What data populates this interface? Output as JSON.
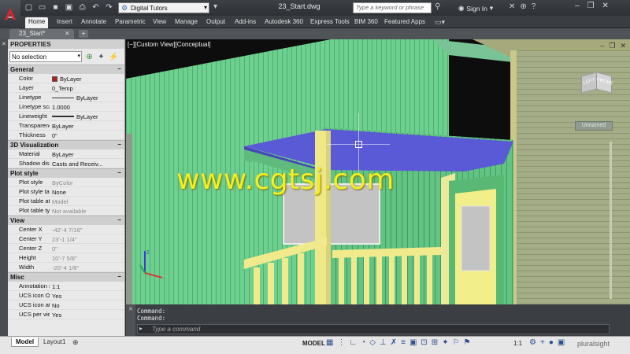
{
  "window": {
    "doc_title": "23_Start.dwg",
    "workspace": "Digital Tutors",
    "search_placeholder": "Type a keyword or phrase",
    "sign_in": "Sign In"
  },
  "ribbon": {
    "tabs": [
      "Home",
      "Insert",
      "Annotate",
      "Parametric",
      "View",
      "Manage",
      "Output",
      "Add-ins",
      "Autodesk 360",
      "Express Tools",
      "BIM 360",
      "Featured Apps"
    ],
    "active": "Home"
  },
  "file_tab": {
    "name": "23_Start*"
  },
  "properties": {
    "title": "PROPERTIES",
    "selection": "No selection",
    "sections": {
      "general": {
        "title": "General",
        "rows": [
          {
            "k": "Color",
            "v": "ByLayer"
          },
          {
            "k": "Layer",
            "v": "0_Temp"
          },
          {
            "k": "Linetype",
            "v": "ByLayer"
          },
          {
            "k": "Linetype scale",
            "v": "1.0000"
          },
          {
            "k": "Lineweight",
            "v": "ByLayer"
          },
          {
            "k": "Transparency",
            "v": "ByLayer"
          },
          {
            "k": "Thickness",
            "v": "0\""
          }
        ]
      },
      "viz3d": {
        "title": "3D Visualization",
        "rows": [
          {
            "k": "Material",
            "v": "ByLayer"
          },
          {
            "k": "Shadow disp...",
            "v": "Casts and Receiv..."
          }
        ]
      },
      "plot": {
        "title": "Plot style",
        "rows": [
          {
            "k": "Plot style",
            "v": "ByColor"
          },
          {
            "k": "Plot style ta...",
            "v": "None"
          },
          {
            "k": "Plot table att...",
            "v": "Model"
          },
          {
            "k": "Plot table ty...",
            "v": "Not available"
          }
        ]
      },
      "view": {
        "title": "View",
        "rows": [
          {
            "k": "Center X",
            "v": "-42'-4 7/16\""
          },
          {
            "k": "Center Y",
            "v": "23'-1 1/4\""
          },
          {
            "k": "Center Z",
            "v": "0\""
          },
          {
            "k": "Height",
            "v": "10'-7 5/8\""
          },
          {
            "k": "Width",
            "v": "-20'-4 1/8\""
          }
        ]
      },
      "misc": {
        "title": "Misc",
        "rows": [
          {
            "k": "Annotation s...",
            "v": "1:1"
          },
          {
            "k": "UCS icon On",
            "v": "Yes"
          },
          {
            "k": "UCS icon at...",
            "v": "No"
          },
          {
            "k": "UCS per vie...",
            "v": "Yes"
          }
        ]
      }
    }
  },
  "viewport": {
    "label": "[−][Custom View][Conceptual]",
    "viewcube_left": "LEFT",
    "viewcube_front": "FRONT",
    "named_view": "Unnamed",
    "watermark": "www.cgtsj.com"
  },
  "command": {
    "history": [
      "Command:",
      "Command:"
    ],
    "placeholder": "Type a command"
  },
  "statusbar": {
    "tabs": [
      "Model",
      "Layout1"
    ],
    "model_label": "MODEL",
    "scale": "1:1",
    "brand": "pluralsight"
  },
  "colors": {
    "siding_green": "#6ed08f",
    "soffit_blue": "#5a59d6",
    "trim_yellow": "#f2ee8a",
    "window_gray": "#c3c3c3",
    "layer_color": "#b21d1d"
  }
}
